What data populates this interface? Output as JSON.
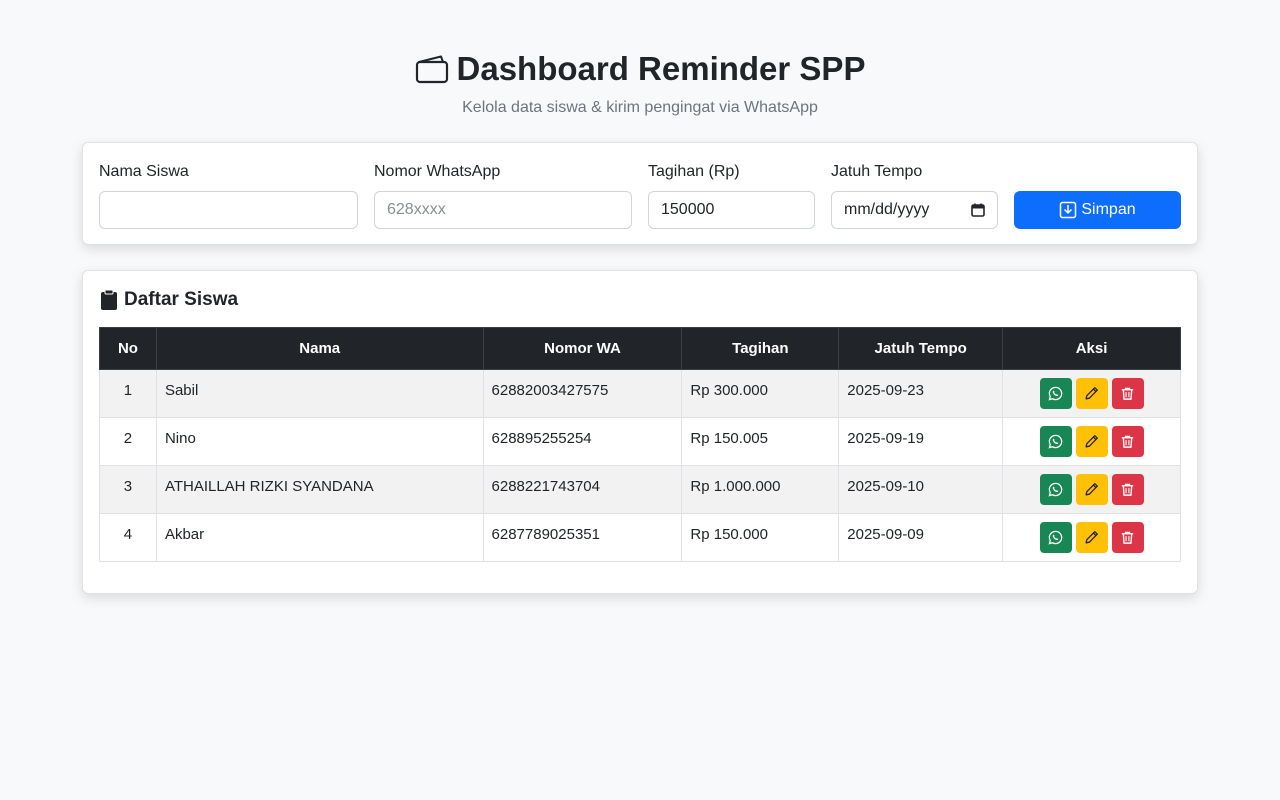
{
  "header": {
    "title": "Dashboard Reminder SPP",
    "subtitle": "Kelola data siswa & kirim pengingat via WhatsApp"
  },
  "form": {
    "name_label": "Nama Siswa",
    "name_value": "",
    "wa_label": "Nomor WhatsApp",
    "wa_placeholder": "628xxxx",
    "bill_label": "Tagihan (Rp)",
    "bill_value": "150000",
    "due_label": "Jatuh Tempo",
    "due_placeholder": "mm/dd/yyyy",
    "save_label": "Simpan"
  },
  "list": {
    "title": "Daftar Siswa",
    "columns": [
      "No",
      "Nama",
      "Nomor WA",
      "Tagihan",
      "Jatuh Tempo",
      "Aksi"
    ],
    "rows": [
      {
        "no": "1",
        "name": "Sabil",
        "wa": "62882003427575",
        "bill": "Rp 300.000",
        "due": "2025-09-23"
      },
      {
        "no": "2",
        "name": "Nino",
        "wa": "628895255254",
        "bill": "Rp 150.005",
        "due": "2025-09-19"
      },
      {
        "no": "3",
        "name": "ATHAILLAH RIZKI SYANDANA",
        "wa": "6288221743704",
        "bill": "Rp 1.000.000",
        "due": "2025-09-10"
      },
      {
        "no": "4",
        "name": "Akbar",
        "wa": "6287789025351",
        "bill": "Rp 150.000",
        "due": "2025-09-09"
      }
    ]
  },
  "icons": {
    "title": "wallet-icon",
    "save": "download-icon",
    "list": "clipboard-icon",
    "send": "whatsapp-icon",
    "edit": "pencil-icon",
    "delete": "trash-icon"
  },
  "colors": {
    "primary": "#0d6efd",
    "success": "#198754",
    "warning": "#ffc107",
    "danger": "#dc3545",
    "table_header": "#212529"
  }
}
